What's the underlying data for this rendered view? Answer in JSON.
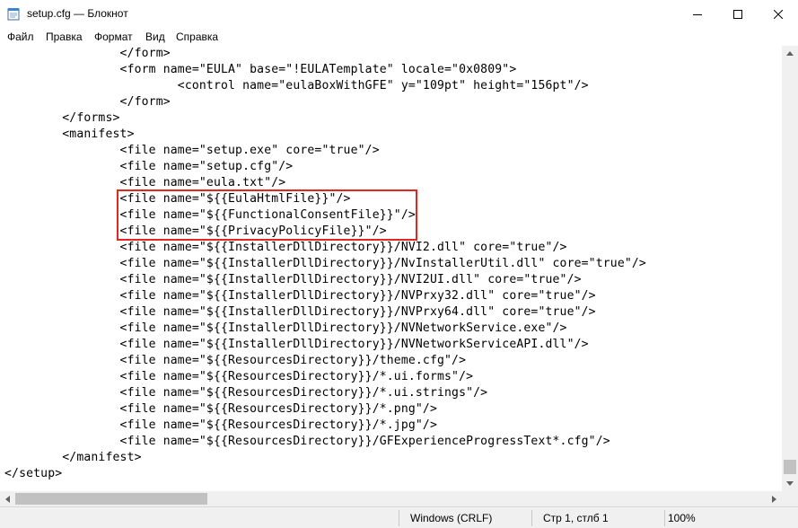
{
  "window": {
    "title": "setup.cfg — Блокнот",
    "app_icon": "notepad-icon",
    "controls": [
      "minimize-icon",
      "maximize-icon",
      "close-icon"
    ]
  },
  "menu": {
    "items": [
      "Файл",
      "Правка",
      "Формат",
      "Вид",
      "Справка"
    ]
  },
  "editor": {
    "lines": [
      "                </form>",
      "                <form name=\"EULA\" base=\"!EULATemplate\" locale=\"0x0809\">",
      "                        <control name=\"eulaBoxWithGFE\" y=\"109pt\" height=\"156pt\"/>",
      "                </form>",
      "        </forms>",
      "        <manifest>",
      "                <file name=\"setup.exe\" core=\"true\"/>",
      "                <file name=\"setup.cfg\"/>",
      "                <file name=\"eula.txt\"/>",
      "                <file name=\"${{EulaHtmlFile}}\"/>",
      "                <file name=\"${{FunctionalConsentFile}}\"/>",
      "                <file name=\"${{PrivacyPolicyFile}}\"/>",
      "                <file name=\"${{InstallerDllDirectory}}/NVI2.dll\" core=\"true\"/>",
      "                <file name=\"${{InstallerDllDirectory}}/NvInstallerUtil.dll\" core=\"true\"/>",
      "                <file name=\"${{InstallerDllDirectory}}/NVI2UI.dll\" core=\"true\"/>",
      "                <file name=\"${{InstallerDllDirectory}}/NVPrxy32.dll\" core=\"true\"/>",
      "                <file name=\"${{InstallerDllDirectory}}/NVPrxy64.dll\" core=\"true\"/>",
      "                <file name=\"${{InstallerDllDirectory}}/NVNetworkService.exe\"/>",
      "                <file name=\"${{InstallerDllDirectory}}/NVNetworkServiceAPI.dll\"/>",
      "                <file name=\"${{ResourcesDirectory}}/theme.cfg\"/>",
      "                <file name=\"${{ResourcesDirectory}}/*.ui.forms\"/>",
      "                <file name=\"${{ResourcesDirectory}}/*.ui.strings\"/>",
      "                <file name=\"${{ResourcesDirectory}}/*.png\"/>",
      "                <file name=\"${{ResourcesDirectory}}/*.jpg\"/>",
      "                <file name=\"${{ResourcesDirectory}}/GFExperienceProgressText*.cfg\"/>",
      "        </manifest>",
      "</setup>"
    ],
    "highlight_color": "#e0281f"
  },
  "statusbar": {
    "line_ending": "Windows (CRLF)",
    "position": "Стр 1, стлб 1",
    "zoom": "100%"
  }
}
